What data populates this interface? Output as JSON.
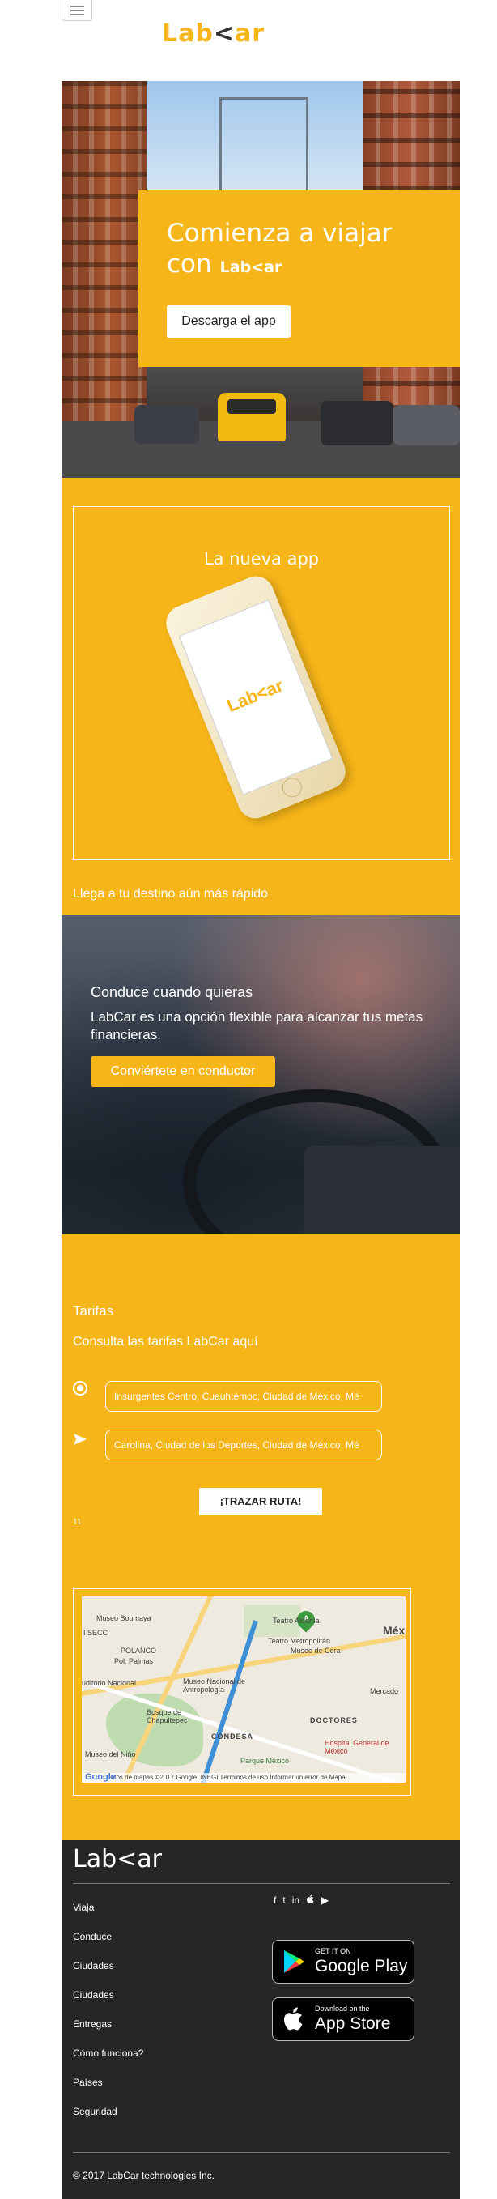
{
  "header": {
    "logo": {
      "lab": "Lab",
      "lt": "<",
      "ar": "ar"
    }
  },
  "hero": {
    "title_line1": "Comienza a viajar",
    "title_line2": "con",
    "title_logo": "Lab<ar",
    "button": "Descarga el app"
  },
  "app": {
    "title": "La nueva app",
    "phone_logo": "Lab<ar",
    "caption": "Llega a tu destino aún más rápido"
  },
  "drive": {
    "title": "Conduce cuando quieras",
    "text": "LabCar es una opción flexible para alcanzar tus metas financieras.",
    "button": "Conviértete en conductor"
  },
  "rates": {
    "title": "Tarifas",
    "subtitle": "Consulta las tarifas LabCar aquí",
    "origin_value": "Insurgentes Centro, Cuauhtémoc, Ciudad de México, Mé",
    "destination_value": "Carolina, Ciudad de los Deportes, Ciudad de México, Mé",
    "route_button": "¡TRAZAR RUTA!",
    "result": "11",
    "map": {
      "labels": [
        "Museo Soumaya",
        "I SECC",
        "POLANCO",
        "Pol. Palmas",
        "Museo Nacional de Antropología",
        "uditorio Nacional",
        "Bosque de Chapultepec",
        "CONDESA",
        "Museo de Cera",
        "Teatro Metropolitán",
        "Teatro Aldama",
        "DOCTORES",
        "Hospital General de México",
        "Parque México",
        "Mercado",
        "Museo del Niño",
        "Méx"
      ],
      "pin_label": "A",
      "footer": "Datos de mapas ©2017 Google, INEGI   Términos de uso   Informar un error de Mapa",
      "google_logo": "Google"
    }
  },
  "footer": {
    "logo": "Lab<ar",
    "links": [
      "Viaja",
      "Conduce",
      "Ciudades",
      "Ciudades",
      "Entregas",
      "Cómo funciona?",
      "Países",
      "Seguridad"
    ],
    "social": [
      "f",
      "t",
      "in",
      "",
      "▶"
    ],
    "google_play": {
      "small": "GET IT ON",
      "big": "Google Play"
    },
    "app_store": {
      "small": "Download on the",
      "big": "App Store"
    },
    "copyright": "© 2017 LabCar technologies Inc."
  },
  "colors": {
    "brand_yellow": "#f6b519",
    "footer_dark": "#262626"
  }
}
